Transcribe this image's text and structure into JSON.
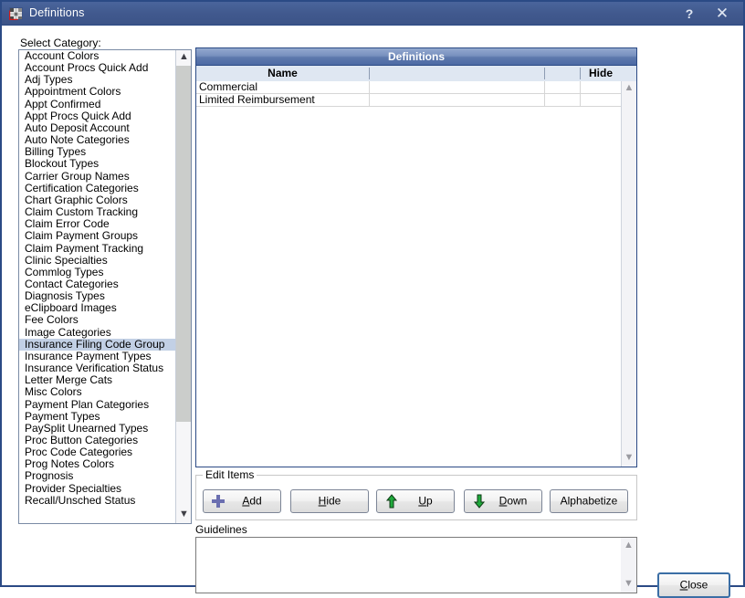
{
  "window": {
    "title": "Definitions",
    "icon": "grid-table-icon",
    "help_label": "?",
    "close_label": "✕"
  },
  "left_panel": {
    "label": "Select Category:",
    "selected": "Insurance Filing Code Group",
    "items": [
      "Account Colors",
      "Account Procs Quick Add",
      "Adj Types",
      "Appointment Colors",
      "Appt Confirmed",
      "Appt Procs Quick Add",
      "Auto Deposit Account",
      "Auto Note Categories",
      "Billing Types",
      "Blockout Types",
      "Carrier Group Names",
      "Certification Categories",
      "Chart Graphic Colors",
      "Claim Custom Tracking",
      "Claim Error Code",
      "Claim Payment Groups",
      "Claim Payment Tracking",
      "Clinic Specialties",
      "Commlog Types",
      "Contact Categories",
      "Diagnosis Types",
      "eClipboard Images",
      "Fee Colors",
      "Image Categories",
      "Insurance Filing Code Group",
      "Insurance Payment Types",
      "Insurance Verification Status",
      "Letter Merge Cats",
      "Misc Colors",
      "Payment Plan Categories",
      "Payment Types",
      "PaySplit Unearned Types",
      "Proc Button Categories",
      "Proc Code Categories",
      "Prog Notes Colors",
      "Prognosis",
      "Provider Specialties",
      "Recall/Unsched Status"
    ],
    "scroll_up_icon": "chevron-up-icon",
    "scroll_down_icon": "chevron-down-icon"
  },
  "grid": {
    "title": "Definitions",
    "columns": [
      "Name",
      "",
      "",
      "Hide"
    ],
    "rows": [
      {
        "name": "Commercial",
        "col2": "",
        "col3": "",
        "hide": ""
      },
      {
        "name": "Limited Reimbursement",
        "col2": "",
        "col3": "",
        "hide": ""
      }
    ],
    "scroll_up_icon": "chevron-up-icon",
    "scroll_down_icon": "chevron-down-icon"
  },
  "edit_items": {
    "label": "Edit Items",
    "buttons": [
      {
        "id": "add",
        "label": "Add",
        "mnemonic": "A",
        "icon": "plus-icon",
        "icon_color": "#6b6fb0"
      },
      {
        "id": "hide",
        "label": "Hide",
        "mnemonic": "H",
        "icon": "",
        "icon_color": ""
      },
      {
        "id": "up",
        "label": "Up",
        "mnemonic": "U",
        "icon": "arrow-up-icon",
        "icon_color": "#1faa3c"
      },
      {
        "id": "down",
        "label": "Down",
        "mnemonic": "D",
        "icon": "arrow-down-icon",
        "icon_color": "#1faa3c"
      },
      {
        "id": "alphabetize",
        "label": "Alphabetize",
        "mnemonic": "",
        "icon": "",
        "icon_color": ""
      }
    ]
  },
  "guidelines": {
    "label": "Guidelines",
    "value": "",
    "scroll_up_icon": "chevron-up-icon",
    "scroll_down_icon": "chevron-down-icon"
  },
  "footer": {
    "close_label": "Close",
    "close_mnemonic": "C"
  },
  "colors": {
    "titlebar": "#41598e",
    "window_border": "#2b4a85",
    "grid_header": "#5d79ad",
    "selection": "#c2d0e5",
    "accent_green": "#1faa3c",
    "accent_purple": "#6b6fb0"
  }
}
